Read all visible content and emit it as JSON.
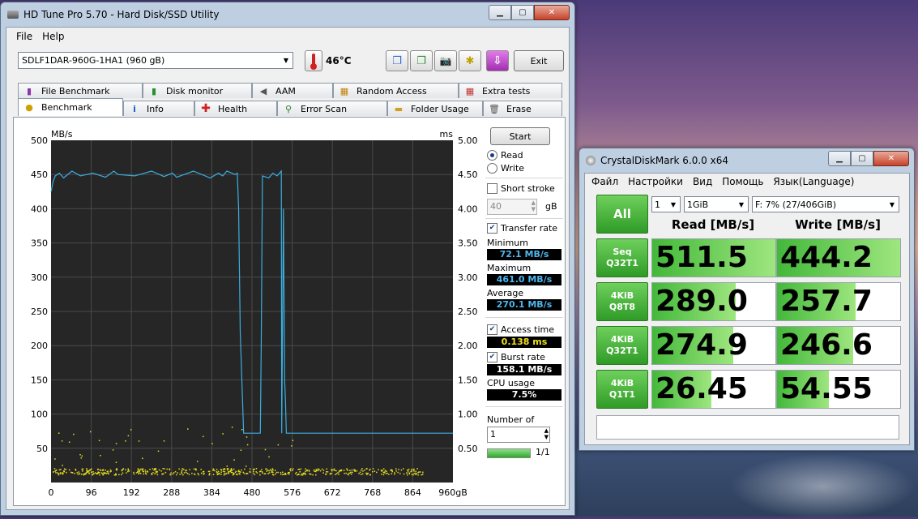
{
  "hdtune": {
    "title": "HD Tune Pro 5.70 - Hard Disk/SSD Utility",
    "menu": [
      "File",
      "Help"
    ],
    "drive": "SDLF1DAR-960G-1HA1 (960 gB)",
    "temperature": "46°C",
    "exit_label": "Exit",
    "tabs_top": [
      "File Benchmark",
      "Disk monitor",
      "AAM",
      "Random Access",
      "Extra tests"
    ],
    "tabs_bottom": [
      "Benchmark",
      "Info",
      "Health",
      "Error Scan",
      "Folder Usage",
      "Erase"
    ],
    "start_label": "Start",
    "read_label": "Read",
    "write_label": "Write",
    "short_stroke_label": "Short stroke",
    "stroke_value": "40",
    "stroke_unit": "gB",
    "transfer_rate_label": "Transfer rate",
    "minimum_label": "Minimum",
    "minimum_value": "72.1 MB/s",
    "maximum_label": "Maximum",
    "maximum_value": "461.0 MB/s",
    "average_label": "Average",
    "average_value": "270.1 MB/s",
    "access_time_label": "Access time",
    "access_time_value": "0.138 ms",
    "burst_rate_label": "Burst rate",
    "burst_rate_value": "158.1 MB/s",
    "cpu_usage_label": "CPU usage",
    "cpu_usage_value": "7.5%",
    "passes_label": "Number of passes",
    "passes_value": "1",
    "progress_label": "1/1",
    "progress_fraction": 1.0,
    "colors": {
      "read_line": "#3aaee0",
      "access_dots": "#e8e020",
      "plot_bg": "#262626",
      "grid": "#4a4a4a",
      "minimum": "#4fb6ee",
      "maximum": "#4fb6ee",
      "average": "#4fb6ee",
      "access": "#f0e020",
      "burst": "#ffffff",
      "cpu": "#ffffff"
    }
  },
  "chart_data": {
    "type": "line",
    "y_left_unit": "MB/s",
    "y_right_unit": "ms",
    "ylim_left": [
      0,
      500
    ],
    "ylim_right": [
      0,
      5
    ],
    "y_left_ticks": [
      "500",
      "450",
      "400",
      "350",
      "300",
      "250",
      "200",
      "150",
      "100",
      "50"
    ],
    "y_right_ticks": [
      "5.00",
      "4.50",
      "4.00",
      "3.50",
      "3.00",
      "2.50",
      "2.00",
      "1.50",
      "1.00",
      "0.50"
    ],
    "xlim": [
      0,
      960
    ],
    "x_ticks": [
      "0",
      "96",
      "192",
      "288",
      "384",
      "480",
      "576",
      "672",
      "768",
      "864",
      "960gB"
    ],
    "series": [
      {
        "x": [
          0,
          5,
          10,
          20,
          30,
          50,
          70,
          100,
          130,
          150,
          160,
          200,
          240,
          270,
          290,
          300,
          340,
          360,
          380,
          400,
          410,
          420,
          440,
          445,
          448,
          452,
          460,
          470,
          480,
          490,
          500,
          502,
          505,
          520,
          530,
          540,
          550,
          551,
          555,
          558,
          560,
          562,
          565,
          600,
          700,
          800,
          900,
          960
        ],
        "values": [
          425,
          440,
          448,
          452,
          445,
          455,
          448,
          452,
          446,
          455,
          450,
          448,
          455,
          447,
          452,
          446,
          455,
          450,
          445,
          452,
          448,
          455,
          450,
          452,
          400,
          220,
          72,
          72,
          72,
          72,
          72,
          200,
          448,
          445,
          452,
          448,
          455,
          72,
          400,
          150,
          120,
          72,
          72,
          72,
          72,
          72,
          72,
          72
        ]
      }
    ]
  },
  "cdm": {
    "title": "CrystalDiskMark 6.0.0 x64",
    "menu": [
      "Файл",
      "Настройки",
      "Вид",
      "Помощь",
      "Язык(Language)"
    ],
    "all_label": "All",
    "count": "1",
    "size": "1GiB",
    "drive": "F: 7% (27/406GiB)",
    "read_header": "Read [MB/s]",
    "write_header": "Write [MB/s]",
    "rows": [
      {
        "label1": "Seq",
        "label2": "Q32T1",
        "read": "511.5",
        "write": "444.2",
        "read_fill": 1.0,
        "write_fill": 1.0
      },
      {
        "label1": "4KiB",
        "label2": "Q8T8",
        "read": "289.0",
        "write": "257.7",
        "read_fill": 0.68,
        "write_fill": 0.64
      },
      {
        "label1": "4KiB",
        "label2": "Q32T1",
        "read": "274.9",
        "write": "246.6",
        "read_fill": 0.66,
        "write_fill": 0.62
      },
      {
        "label1": "4KiB",
        "label2": "Q1T1",
        "read": "26.45",
        "write": "54.55",
        "read_fill": 0.48,
        "write_fill": 0.42
      }
    ]
  }
}
